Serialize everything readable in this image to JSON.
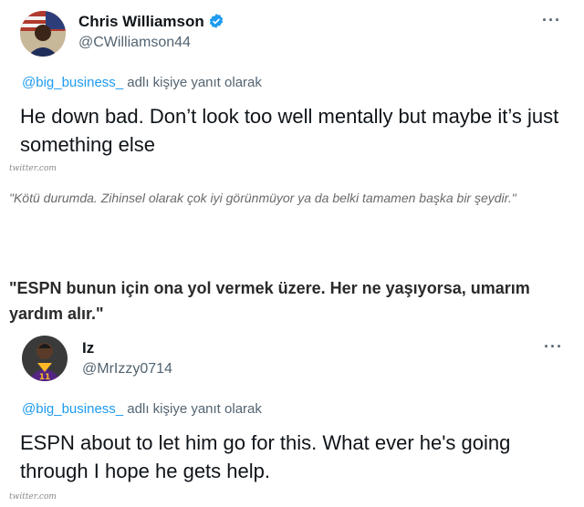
{
  "tweet1": {
    "name": "Chris Williamson",
    "handle": "@CWilliamson44",
    "more_label": "···",
    "reply_mention": "@big_business_",
    "reply_suffix": " adlı kişiye yanıt olarak",
    "text": "He down bad. Don’t look too well mentally but maybe it’s just something else",
    "source": "twitter.com"
  },
  "translation1": "\"Kötü durumda. Zihinsel olarak çok iyi görünmüyor ya da belki tamamen başka bir şeydir.\"",
  "quote2": "\"ESPN bunun için ona yol vermek üzere. Her ne yaşıyorsa, umarım yardım alır.\"",
  "tweet2": {
    "name": "Iz",
    "handle": "@MrIzzy0714",
    "more_label": "···",
    "jersey_number": "11",
    "reply_mention": "@big_business_",
    "reply_suffix": " adlı kişiye yanıt olarak",
    "text": "ESPN about to let him go for this. What ever he's going through I hope he gets help.",
    "source": "twitter.com"
  },
  "colors": {
    "verified": "#1d9bf0",
    "mention": "#1d9bf0",
    "muted": "#536471"
  }
}
